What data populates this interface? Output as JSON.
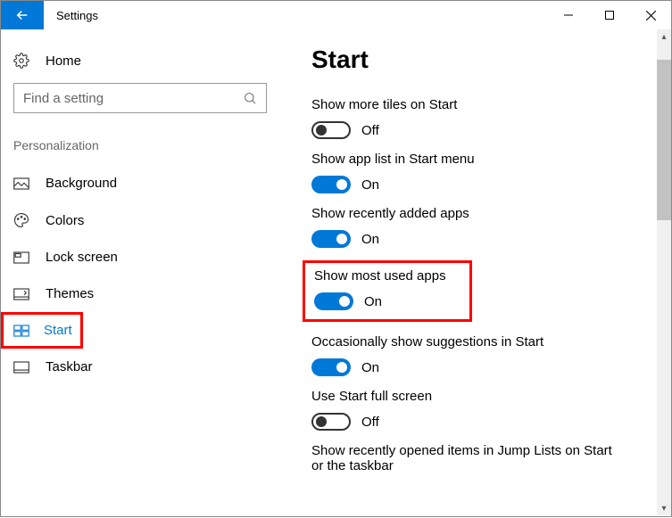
{
  "titlebar": {
    "title": "Settings"
  },
  "sidebar": {
    "home_label": "Home",
    "search_placeholder": "Find a setting",
    "category": "Personalization",
    "items": [
      {
        "label": "Background"
      },
      {
        "label": "Colors"
      },
      {
        "label": "Lock screen"
      },
      {
        "label": "Themes"
      },
      {
        "label": "Start"
      },
      {
        "label": "Taskbar"
      }
    ]
  },
  "main": {
    "title": "Start",
    "settings": [
      {
        "label": "Show more tiles on Start",
        "state": "Off",
        "on": false
      },
      {
        "label": "Show app list in Start menu",
        "state": "On",
        "on": true
      },
      {
        "label": "Show recently added apps",
        "state": "On",
        "on": true
      },
      {
        "label": "Show most used apps",
        "state": "On",
        "on": true
      },
      {
        "label": "Occasionally show suggestions in Start",
        "state": "On",
        "on": true
      },
      {
        "label": "Use Start full screen",
        "state": "Off",
        "on": false
      },
      {
        "label": "Show recently opened items in Jump Lists on Start or the taskbar"
      }
    ]
  }
}
